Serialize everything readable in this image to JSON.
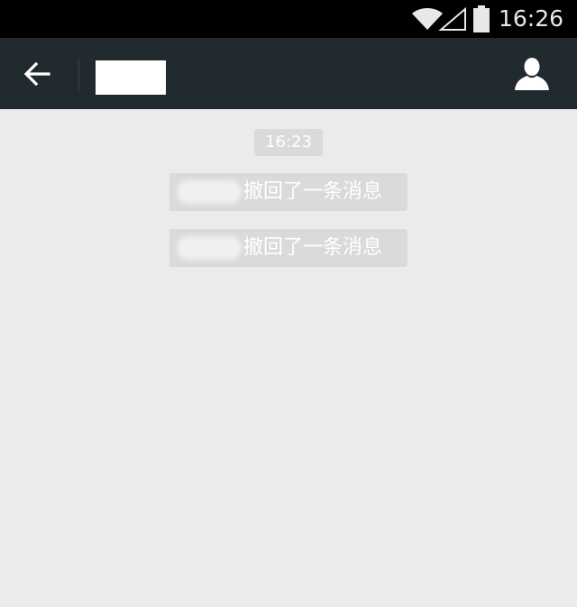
{
  "status_bar": {
    "time": "16:26",
    "icons": [
      "wifi-icon",
      "cell-signal-icon",
      "battery-icon"
    ]
  },
  "header": {
    "back_icon": "arrow-left-icon",
    "chat_name": "",
    "profile_icon": "person-icon"
  },
  "chat": {
    "timestamp": "16:23",
    "system_messages": [
      {
        "sender": "",
        "text": "撤回了一条消息"
      },
      {
        "sender": "",
        "text": "撤回了一条消息"
      }
    ]
  },
  "colors": {
    "status_bar_bg": "#000000",
    "title_bar_bg": "#212a2e",
    "chat_bg": "#ebebeb",
    "bubble_bg": "#dadada",
    "bubble_text": "#ffffff"
  }
}
